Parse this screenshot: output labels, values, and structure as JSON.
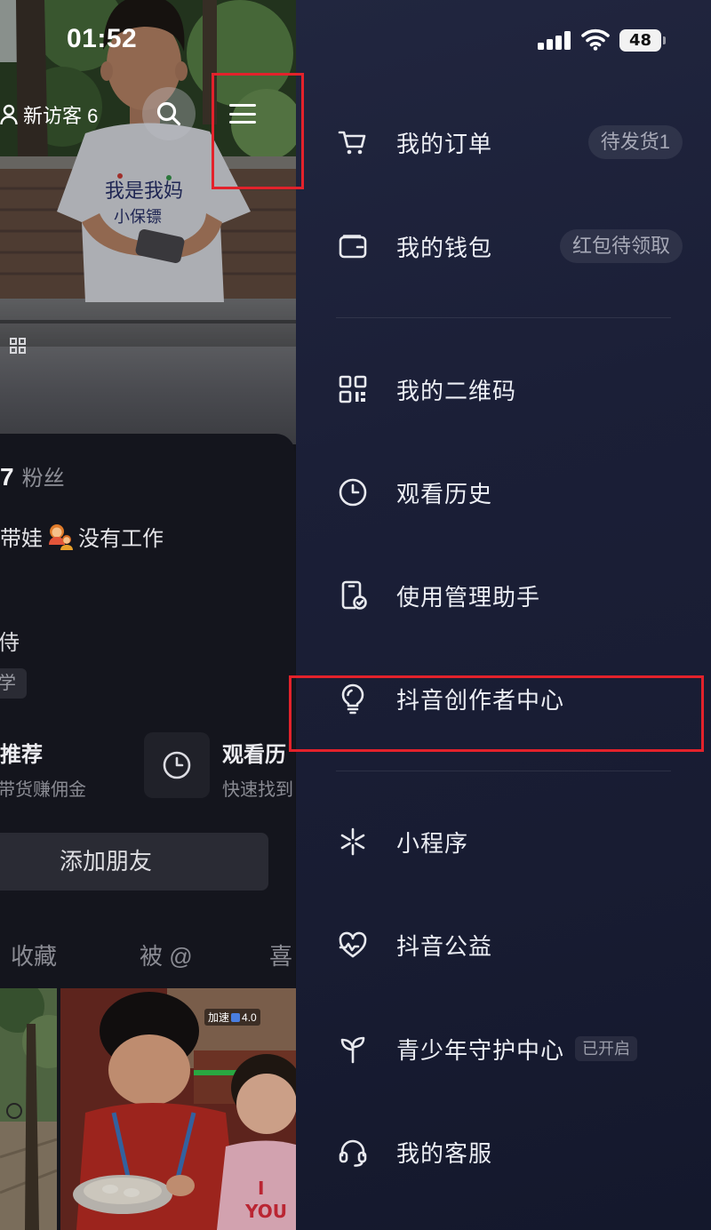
{
  "status_bar": {
    "time": "01:52",
    "battery_level": "48",
    "icons": [
      "cellular-signal-icon",
      "wifi-icon",
      "battery-icon"
    ]
  },
  "profile_header": {
    "visitors_label": "新访客 6",
    "icons": [
      "person-icon",
      "search-icon",
      "hamburger-menu-icon"
    ]
  },
  "cover_photo": {
    "shirt_text_line1": "我是我妈",
    "shirt_text_line2": "小保镖"
  },
  "profile": {
    "fans_count": "7",
    "fans_label": "粉丝",
    "bio_before_emoji": "带娃",
    "bio_emoji_icon": "family-emoji-icon",
    "bio_after_emoji": "没有工作",
    "partial_line": "侍",
    "tag": "学",
    "shortcuts": [
      {
        "title": "推荐",
        "subtitle": "带货赚佣金"
      },
      {
        "title": "观看历",
        "subtitle": "快速找到",
        "icon": "clock-icon"
      }
    ],
    "add_friend_label": "添加朋友",
    "tabs": [
      "收藏",
      "被 @",
      "喜"
    ]
  },
  "video_grid": {
    "speed_badge_label": "加速",
    "speed_badge_value": "4.0",
    "photo_text_line1": "I",
    "photo_text_line2": "YOU"
  },
  "drawer": {
    "items": [
      {
        "label": "我的订单",
        "icon": "cart-icon",
        "badge": "待发货1"
      },
      {
        "label": "我的钱包",
        "icon": "wallet-icon",
        "badge": "红包待领取"
      },
      {
        "label": "我的二维码",
        "icon": "qr-code-icon"
      },
      {
        "label": "观看历史",
        "icon": "clock-icon"
      },
      {
        "label": "使用管理助手",
        "icon": "phone-check-icon"
      },
      {
        "label": "抖音创作者中心",
        "icon": "lightbulb-icon"
      },
      {
        "label": "小程序",
        "icon": "mini-program-icon"
      },
      {
        "label": "抖音公益",
        "icon": "heart-pulse-icon"
      },
      {
        "label": "青少年守护中心",
        "icon": "sprout-icon",
        "status_tag": "已开启"
      },
      {
        "label": "我的客服",
        "icon": "headset-icon"
      }
    ]
  },
  "colors": {
    "drawer_background": "#1b1f37",
    "profile_card_background": "#14151d",
    "annotation_red": "#e3222b",
    "menu_text": "#eceef4",
    "badge_text": "#a7a9b7"
  }
}
